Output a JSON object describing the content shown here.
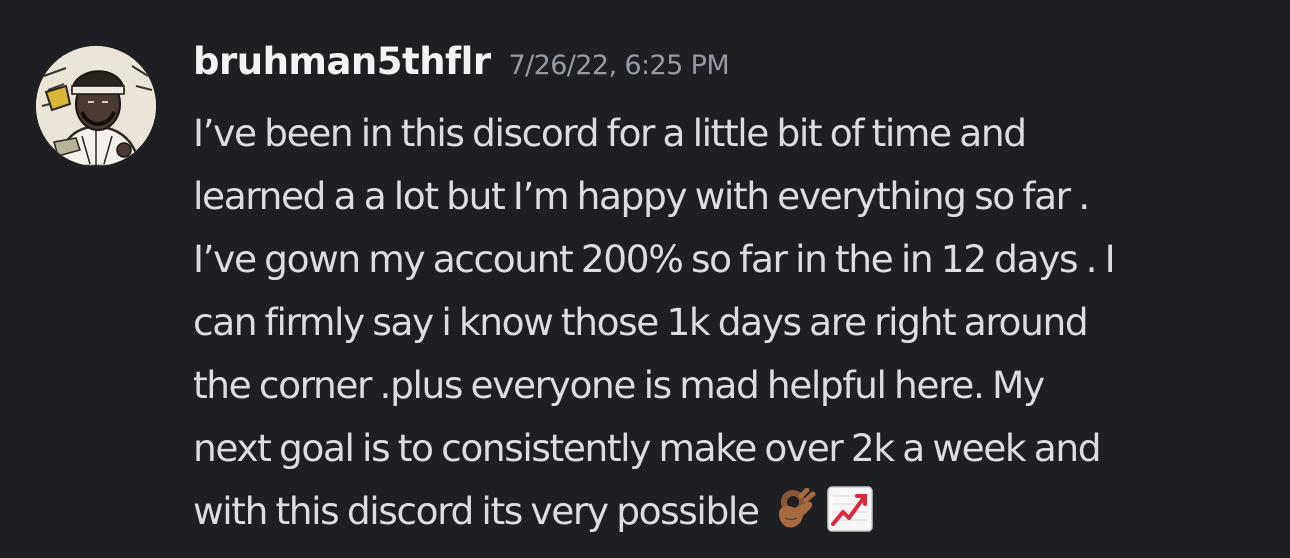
{
  "message": {
    "username": "bruhman5thflr",
    "timestamp": "7/26/22, 6:25 PM",
    "lines": [
      "I’ve been in this discord for a little bit of time and",
      "learned a a lot but I’m happy with everything so far .",
      "I’ve gown my account 200% so far in the in 12 days . I",
      "can firmly say i know those 1k days are right around",
      "the corner .plus everyone is mad helpful here. My",
      "next goal is to consistently make over 2k a week and",
      "with this discord its very possible"
    ],
    "emojis": [
      "ok-hand-emoji",
      "chart-increasing-emoji"
    ]
  },
  "colors": {
    "background": "#1e1f22",
    "username": "#f2f3f5",
    "timestamp": "#949ba4",
    "text": "#dbdee1"
  }
}
